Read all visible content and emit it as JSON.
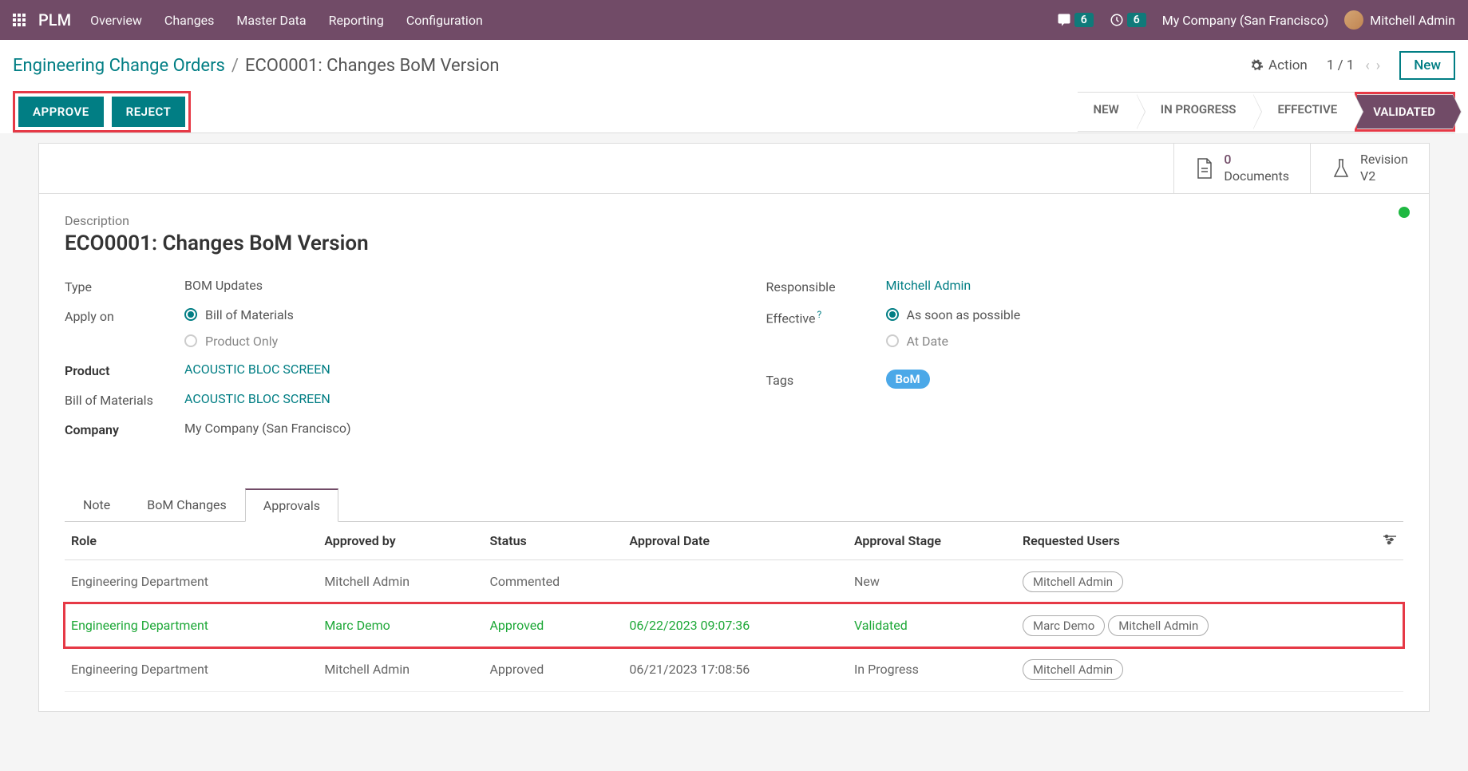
{
  "nav": {
    "app": "PLM",
    "links": [
      "Overview",
      "Changes",
      "Master Data",
      "Reporting",
      "Configuration"
    ],
    "chat_badge": "6",
    "clock_badge": "6",
    "company": "My Company (San Francisco)",
    "user": "Mitchell Admin"
  },
  "breadcrumb": {
    "root": "Engineering Change Orders",
    "sep": "/",
    "current": "ECO0001: Changes BoM Version",
    "action_label": "Action",
    "pager": "1 / 1",
    "new_label": "New"
  },
  "status": {
    "approve": "APPROVE",
    "reject": "REJECT",
    "stages": [
      "NEW",
      "IN PROGRESS",
      "EFFECTIVE",
      "VALIDATED"
    ]
  },
  "stats": {
    "docs_count": "0",
    "docs_label": "Documents",
    "rev_label": "Revision",
    "rev_value": "V2"
  },
  "form": {
    "desc_label": "Description",
    "title": "ECO0001: Changes BoM Version",
    "left": {
      "type_label": "Type",
      "type_value": "BOM Updates",
      "apply_label": "Apply on",
      "apply_opt1": "Bill of Materials",
      "apply_opt2": "Product Only",
      "product_label": "Product",
      "product_value": "ACOUSTIC BLOC SCREEN",
      "bom_label": "Bill of Materials",
      "bom_value": "ACOUSTIC BLOC SCREEN",
      "company_label": "Company",
      "company_value": "My Company (San Francisco)"
    },
    "right": {
      "resp_label": "Responsible",
      "resp_value": "Mitchell Admin",
      "eff_label": "Effective",
      "eff_opt1": "As soon as possible",
      "eff_opt2": "At Date",
      "tags_label": "Tags",
      "tag_value": "BoM"
    }
  },
  "tabs": [
    "Note",
    "BoM Changes",
    "Approvals"
  ],
  "table": {
    "headers": [
      "Role",
      "Approved by",
      "Status",
      "Approval Date",
      "Approval Stage",
      "Requested Users"
    ],
    "rows": [
      {
        "role": "Engineering Department",
        "by": "Mitchell Admin",
        "status": "Commented",
        "date": "",
        "stage": "New",
        "users": [
          "Mitchell Admin"
        ],
        "green": false,
        "hl": false
      },
      {
        "role": "Engineering Department",
        "by": "Marc Demo",
        "status": "Approved",
        "date": "06/22/2023 09:07:36",
        "stage": "Validated",
        "users": [
          "Marc Demo",
          "Mitchell Admin"
        ],
        "green": true,
        "hl": true
      },
      {
        "role": "Engineering Department",
        "by": "Mitchell Admin",
        "status": "Approved",
        "date": "06/21/2023 17:08:56",
        "stage": "In Progress",
        "users": [
          "Mitchell Admin"
        ],
        "green": false,
        "hl": false
      }
    ]
  }
}
